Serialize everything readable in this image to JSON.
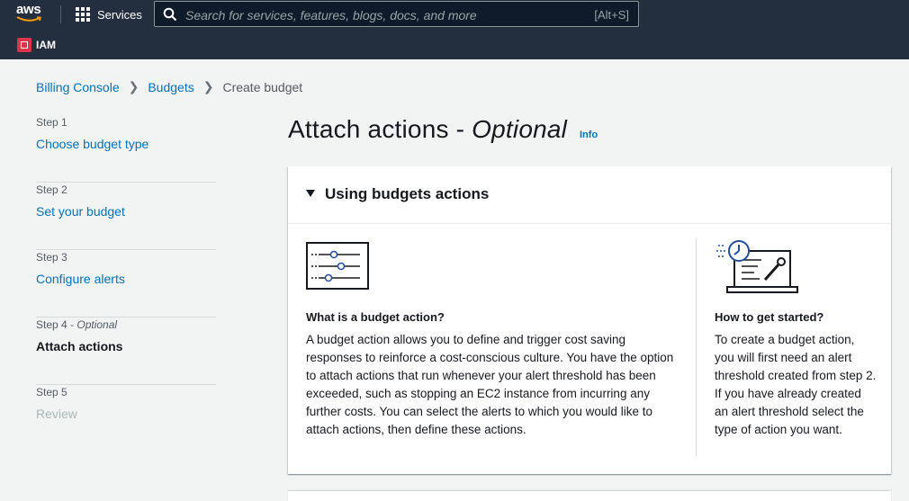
{
  "nav": {
    "logo": "aws",
    "services_label": "Services",
    "search_placeholder": "Search for services, features, blogs, docs, and more",
    "search_shortcut": "[Alt+S]",
    "service_name": "IAM"
  },
  "breadcrumb": {
    "items": [
      "Billing Console",
      "Budgets"
    ],
    "current": "Create budget"
  },
  "steps": [
    {
      "num": "Step 1",
      "title": "Choose budget type"
    },
    {
      "num": "Step 2",
      "title": "Set your budget"
    },
    {
      "num": "Step 3",
      "title": "Configure alerts"
    },
    {
      "num": "Step 4 - ",
      "optional": "Optional",
      "title": "Attach actions"
    },
    {
      "num": "Step 5",
      "title": "Review"
    }
  ],
  "header": {
    "title": "Attach actions - ",
    "title_optional": "Optional",
    "info": "Info"
  },
  "panel": {
    "heading": "Using budgets actions",
    "left_question": "What is a budget action?",
    "left_text": "A budget action allows you to define and trigger cost saving responses to reinforce a cost-conscious culture. You have the option to attach actions that run whenever your alert threshold has been exceeded, such as stopping an EC2 instance from incurring any further costs. You can select the alerts to which you would like to attach actions, then define these actions.",
    "right_question": "How to get started?",
    "right_text": "To create a budget action, you will first need an alert threshold created from step 2. If you have already created an alert threshold select the type of action you want."
  },
  "colors": {
    "nav_bg": "#232f3e",
    "link": "#0073bb",
    "accent_orange": "#ff9900"
  }
}
